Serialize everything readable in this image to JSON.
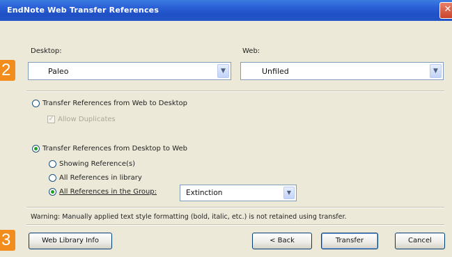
{
  "window": {
    "title": "EndNote Web Transfer References",
    "close_glyph": "✕"
  },
  "badges": {
    "step2": "2",
    "step3": "3"
  },
  "desktop": {
    "label": "Desktop:",
    "value": "Paleo"
  },
  "web": {
    "label": "Web:",
    "value": "Unfiled"
  },
  "option_web_to_desktop": {
    "label": "Transfer References from Web to Desktop",
    "allow_duplicates": "Allow Duplicates"
  },
  "option_desktop_to_web": {
    "label": "Transfer References from Desktop to Web",
    "sub_options": [
      {
        "label": "Showing Reference(s)",
        "selected": false
      },
      {
        "label": "All References in library",
        "selected": false
      },
      {
        "label": "All References in the Group:",
        "selected": true
      }
    ],
    "group_value": "Extinction"
  },
  "warning": "Warning: Manually applied text style formatting (bold, italic, etc.) is not retained using transfer.",
  "buttons": {
    "web_library_info": "Web Library Info",
    "back": "< Back",
    "transfer": "Transfer",
    "cancel": "Cancel"
  },
  "colors": {
    "title_bar": "#2a60d6",
    "dialog_bg": "#ece9d8",
    "badge": "#f28c1c",
    "radio_dot": "#21a121"
  }
}
